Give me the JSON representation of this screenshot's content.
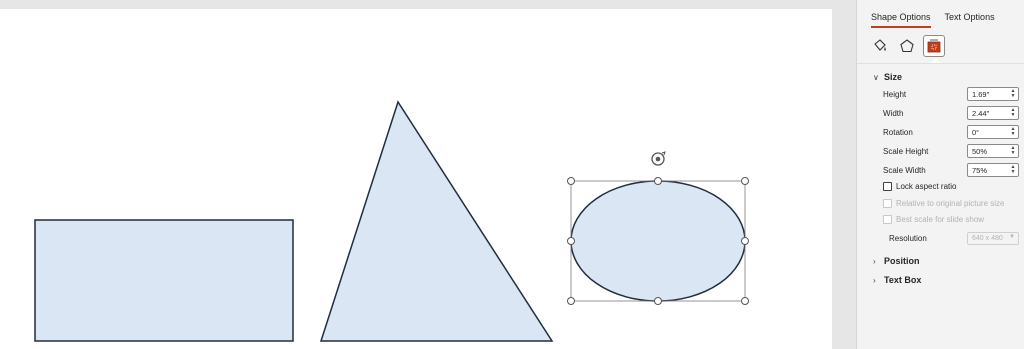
{
  "pane": {
    "tabs": [
      {
        "label": "Shape Options",
        "active": true
      },
      {
        "label": "Text Options",
        "active": false
      }
    ],
    "icons": [
      "fill-line-icon",
      "effects-icon",
      "size-properties-icon"
    ],
    "size_section": {
      "title": "Size",
      "expanded": true,
      "fields": [
        {
          "label": "Height",
          "value": "1.69\""
        },
        {
          "label": "Width",
          "value": "2.44\""
        },
        {
          "label": "Rotation",
          "value": "0°"
        },
        {
          "label": "Scale Height",
          "value": "50%"
        },
        {
          "label": "Scale Width",
          "value": "75%"
        }
      ],
      "lock_aspect": {
        "label": "Lock aspect ratio",
        "checked": false
      },
      "relative_original": {
        "label": "Relative to original picture size",
        "checked": false,
        "disabled": true
      },
      "best_scale": {
        "label": "Best scale for slide show",
        "checked": false,
        "disabled": true
      },
      "resolution": {
        "label": "Resolution",
        "value": "640 x 480",
        "disabled": true
      }
    },
    "position_section": {
      "title": "Position",
      "expanded": false
    },
    "textbox_section": {
      "title": "Text Box",
      "expanded": false
    }
  },
  "colors": {
    "shape_fill": "#dae6f4",
    "shape_stroke": "#1f2d3d",
    "accent": "#c43e1c"
  }
}
